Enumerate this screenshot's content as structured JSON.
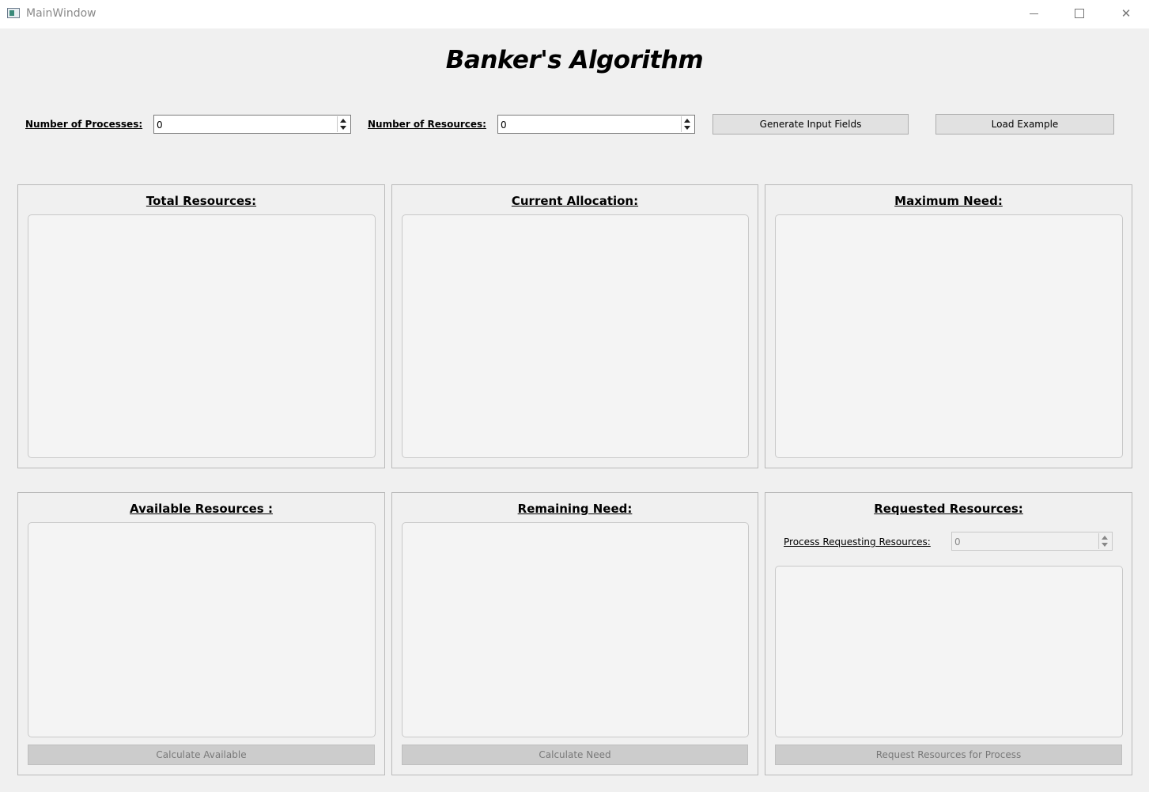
{
  "window": {
    "title": "MainWindow"
  },
  "header": {
    "title": "Banker's Algorithm"
  },
  "controls": {
    "processes_label": "Number of Processes:",
    "processes_value": "0",
    "resources_label": "Number of Resources:",
    "resources_value": "0",
    "generate_button": "Generate Input Fields",
    "load_button": "Load Example"
  },
  "panels": {
    "total": {
      "title": "Total Resources:"
    },
    "allocation": {
      "title": "Current Allocation:"
    },
    "maximum": {
      "title": "Maximum Need:"
    },
    "available": {
      "title": "Available Resources :",
      "button": "Calculate Available"
    },
    "remaining": {
      "title": "Remaining Need:",
      "button": "Calculate Need"
    },
    "requested": {
      "title": "Requested Resources:",
      "process_label": "Process Requesting Resources:",
      "process_value": "0",
      "button": "Request Resources for Process"
    }
  }
}
